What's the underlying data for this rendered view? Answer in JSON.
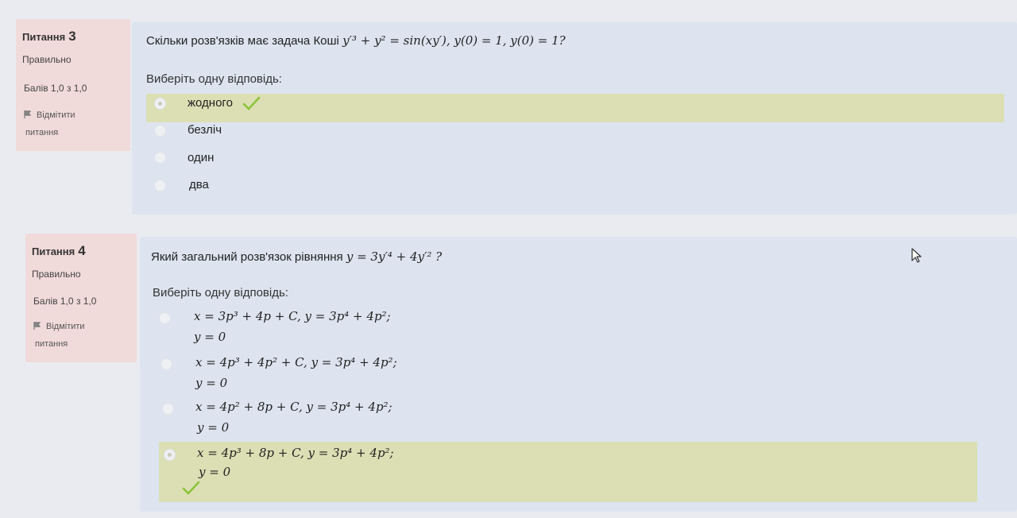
{
  "q3": {
    "label": "Питання",
    "number": "3",
    "state": "Правильно",
    "grade": "Балів 1,0 з 1,0",
    "flag_line1": "Відмітити",
    "flag_line2": "питання",
    "question_prefix": "Скільки розв'язків має задача Коші",
    "question_math": "y′³ + y² = sin(xy′),   y(0) = 1,   y(0) = 1?",
    "prompt": "Виберіть одну відповідь:",
    "answers": [
      {
        "text": "жодного",
        "selected": true,
        "correct": true
      },
      {
        "text": "безліч",
        "selected": false
      },
      {
        "text": "один",
        "selected": false
      },
      {
        "text": "два",
        "selected": false
      }
    ]
  },
  "q4": {
    "label": "Питання",
    "number": "4",
    "state": "Правильно",
    "grade": "Балів 1,0 з 1,0",
    "flag_line1": "Відмітити",
    "flag_line2": "питання",
    "question_prefix": "Який загальний розв'язок рівняння",
    "question_math": "y = 3y′⁴ + 4y′² ?",
    "prompt": "Виберіть одну відповідь:",
    "answers": [
      {
        "line1": "x = 3p³ + 4p + C,  y = 3p⁴ + 4p²;",
        "line2": "y = 0",
        "selected": false
      },
      {
        "line1": "x = 4p³ + 4p² + C,  y = 3p⁴ + 4p²;",
        "line2": "y = 0",
        "selected": false
      },
      {
        "line1": "x = 4p² + 8p + C,  y = 3p⁴ + 4p²;",
        "line2": "y = 0",
        "selected": false
      },
      {
        "line1": "x = 4p³ + 8p + C,  y = 3p⁴ + 4p²;",
        "line2": "y = 0",
        "selected": true,
        "correct": true
      }
    ]
  },
  "colors": {
    "info_bg": "#f1dada",
    "content_bg": "#dde4ef",
    "correct_bg": "#dcdfb4",
    "check": "#8cc43c"
  }
}
